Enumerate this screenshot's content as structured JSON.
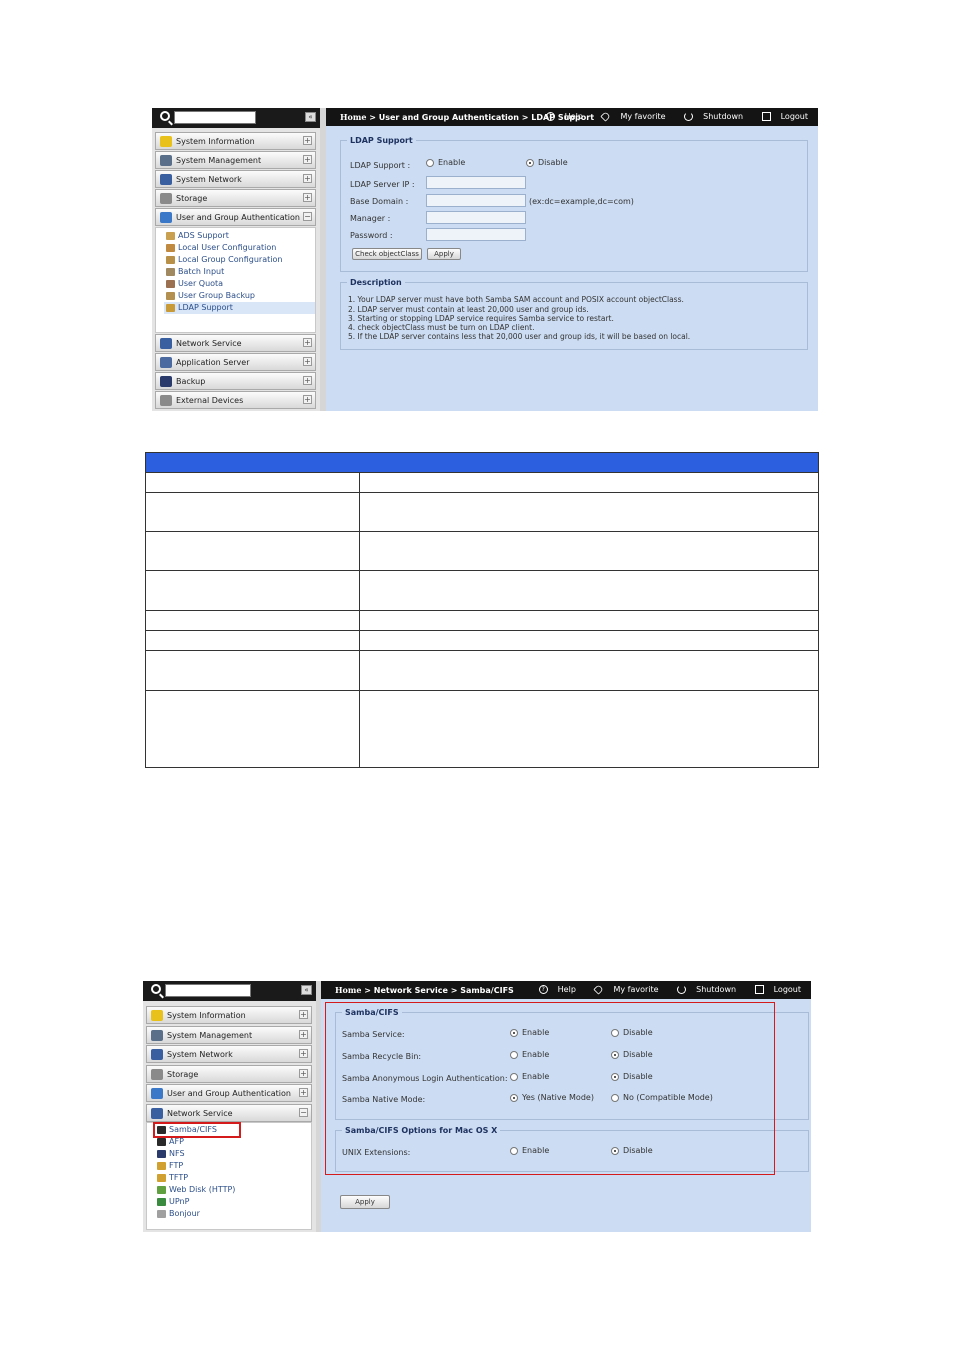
{
  "colors": {
    "topbar": "#141414",
    "main_bg": "#ccdcf2",
    "table_header": "#2b5fe0",
    "highlight_box": "#d41a1a"
  },
  "screenshot1": {
    "sidebar": {
      "collapse_label": "«",
      "items_before": [
        {
          "label": "System Information",
          "icon": "info-icon",
          "toggle": "+"
        },
        {
          "label": "System Management",
          "icon": "tools-icon",
          "toggle": "+"
        },
        {
          "label": "System Network",
          "icon": "network-icon",
          "toggle": "+"
        },
        {
          "label": "Storage",
          "icon": "storage-icon",
          "toggle": "+"
        },
        {
          "label": "User and Group Authentication",
          "icon": "users-icon",
          "toggle": "−"
        }
      ],
      "subitems": [
        {
          "label": "ADS Support",
          "icon": "ads-icon"
        },
        {
          "label": "Local User Configuration",
          "icon": "user-icon"
        },
        {
          "label": "Local Group Configuration",
          "icon": "group-icon"
        },
        {
          "label": "Batch Input",
          "icon": "batch-icon"
        },
        {
          "label": "User Quota",
          "icon": "quota-icon"
        },
        {
          "label": "User Group Backup",
          "icon": "backup-icon"
        },
        {
          "label": "LDAP Support",
          "icon": "ldap-icon"
        }
      ],
      "active_subitem": "LDAP Support",
      "items_after": [
        {
          "label": "Network Service",
          "icon": "network-service-icon",
          "toggle": "+"
        },
        {
          "label": "Application Server",
          "icon": "app-server-icon",
          "toggle": "+"
        },
        {
          "label": "Backup",
          "icon": "backup-icon",
          "toggle": "+"
        },
        {
          "label": "External Devices",
          "icon": "external-icon",
          "toggle": "+"
        }
      ]
    },
    "topbar": {
      "home": "Home",
      "sep": ">",
      "crumb1": "User and Group Authentication",
      "crumb2": "LDAP Support",
      "help": "Help",
      "favorite": "My favorite",
      "shutdown": "Shutdown",
      "logout": "Logout"
    },
    "ldap": {
      "legend": "LDAP Support",
      "support_label": "LDAP Support :",
      "enable": "Enable",
      "disable": "Disable",
      "selected": "disable",
      "server_ip_label": "LDAP Server IP :",
      "base_domain_label": "Base Domain :",
      "base_domain_hint": "(ex:dc=example,dc=com)",
      "manager_label": "Manager :",
      "password_label": "Password :",
      "check_button": "Check objectClass",
      "apply_button": "Apply"
    },
    "description": {
      "legend": "Description",
      "lines": [
        "1. Your LDAP server must have both Samba SAM account and POSIX account objectClass.",
        "2. LDAP server must contain at least 20,000 user and group ids.",
        "3. Starting or stopping LDAP service requires Samba service to restart.",
        "4. check objectClass must be turn on LDAP client.",
        "5. If the LDAP server contains less that 20,000 user and group ids, it will be based on local."
      ]
    }
  },
  "screenshot2": {
    "sidebar": {
      "collapse_label": "«",
      "items_before": [
        {
          "label": "System Information",
          "icon": "info-icon",
          "toggle": "+"
        },
        {
          "label": "System Management",
          "icon": "tools-icon",
          "toggle": "+"
        },
        {
          "label": "System Network",
          "icon": "network-icon",
          "toggle": "+"
        },
        {
          "label": "Storage",
          "icon": "storage-icon",
          "toggle": "+"
        },
        {
          "label": "User and Group Authentication",
          "icon": "users-icon",
          "toggle": "+"
        },
        {
          "label": "Network Service",
          "icon": "network-service-icon",
          "toggle": "−"
        }
      ],
      "subitems": [
        {
          "label": "Samba/CIFS",
          "icon": "samba-icon"
        },
        {
          "label": "AFP",
          "icon": "afp-icon"
        },
        {
          "label": "NFS",
          "icon": "nfs-icon"
        },
        {
          "label": "FTP",
          "icon": "ftp-icon"
        },
        {
          "label": "TFTP",
          "icon": "tftp-icon"
        },
        {
          "label": "Web Disk (HTTP)",
          "icon": "webdisk-icon"
        },
        {
          "label": "UPnP",
          "icon": "upnp-icon"
        },
        {
          "label": "Bonjour",
          "icon": "bonjour-icon"
        }
      ],
      "active_subitem": "Samba/CIFS"
    },
    "topbar": {
      "home": "Home",
      "sep": ">",
      "crumb1": "Network Service",
      "crumb2": "Samba/CIFS",
      "help": "Help",
      "favorite": "My favorite",
      "shutdown": "Shutdown",
      "logout": "Logout"
    },
    "samba": {
      "legend": "Samba/CIFS",
      "rows": [
        {
          "label": "Samba Service:",
          "opt1": "Enable",
          "opt2": "Disable",
          "selected": 1
        },
        {
          "label": "Samba Recycle Bin:",
          "opt1": "Enable",
          "opt2": "Disable",
          "selected": 2
        },
        {
          "label": "Samba Anonymous Login Authentication:",
          "opt1": "Enable",
          "opt2": "Disable",
          "selected": 2
        },
        {
          "label": "Samba Native Mode:",
          "opt1": "Yes (Native Mode)",
          "opt2": "No (Compatible Mode)",
          "selected": 1
        }
      ]
    },
    "macos": {
      "legend": "Samba/CIFS Options for Mac OS X",
      "label": "UNIX Extensions:",
      "opt1": "Enable",
      "opt2": "Disable",
      "selected": 2
    },
    "apply_button": "Apply"
  },
  "table": {
    "header": "",
    "rows": [
      {
        "left": "",
        "right": ""
      },
      {
        "left": "",
        "right": ""
      },
      {
        "left": "",
        "right": ""
      },
      {
        "left": "",
        "right": ""
      },
      {
        "left": "",
        "right": ""
      },
      {
        "left": "",
        "right": ""
      },
      {
        "left": "",
        "right": ""
      },
      {
        "left": "",
        "right": ""
      }
    ]
  }
}
